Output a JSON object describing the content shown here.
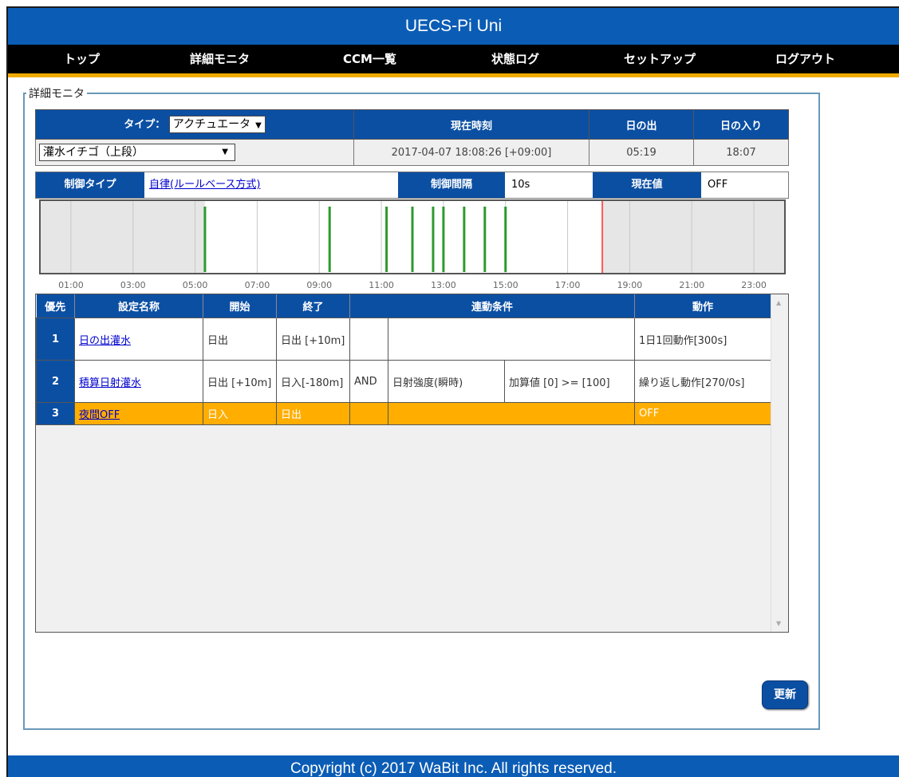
{
  "app_title": "UECS-Pi Uni",
  "nav": [
    "トップ",
    "詳細モニタ",
    "CCM一覧",
    "状態ログ",
    "セットアップ",
    "ログアウト"
  ],
  "section_legend": "詳細モニタ",
  "info": {
    "type_label": "タイプ：",
    "type_value": "アクチュエータ",
    "device_value": "灌水イチゴ（上段）",
    "current_time_label": "現在時刻",
    "current_time": "2017-04-07 18:08:26 [+09:00]",
    "sunrise_label": "日の出",
    "sunrise": "05:19",
    "sunset_label": "日の入り",
    "sunset": "18:07"
  },
  "control": {
    "type_label": "制御タイプ",
    "type_value": "自律(ルールベース方式)",
    "interval_label": "制御間隔",
    "interval_value": "10s",
    "current_label": "現在値",
    "current_value": "OFF"
  },
  "chart_data": {
    "type": "timeline",
    "x_range_hours": [
      0,
      24
    ],
    "x_ticks": [
      "01:00",
      "03:00",
      "05:00",
      "07:00",
      "09:00",
      "11:00",
      "13:00",
      "15:00",
      "17:00",
      "19:00",
      "21:00",
      "23:00"
    ],
    "inactive_before": 5.317,
    "inactive_after": 18.117,
    "current_time": 18.117,
    "on_times": [
      5.317,
      9.333,
      11.167,
      12.0,
      12.667,
      13.0,
      13.667,
      14.333,
      15.0
    ],
    "colors": {
      "on": "#2e9a2e",
      "now": "#ff5a5a",
      "inactive": "#e6e6e6"
    }
  },
  "schedule": {
    "headers": [
      "優先",
      "設定名称",
      "開始",
      "終了",
      "連動条件",
      "動作"
    ],
    "rows": [
      {
        "priority": "1",
        "name": "日の出灌水",
        "start": "日出",
        "end": "日出 [+10m]",
        "logic": "",
        "condition": "",
        "condition_value": "",
        "action": "1日1回動作[300s]"
      },
      {
        "priority": "2",
        "name": "積算日射灌水",
        "start": "日出 [+10m]",
        "end": "日入[-180m]",
        "logic": "AND",
        "condition": "日射強度(瞬時)",
        "condition_value": "加算値 [0] >= [100]",
        "action": "繰り返し動作[270/0s]"
      },
      {
        "priority": "3",
        "name": "夜間OFF",
        "start": "日入",
        "end": "日出",
        "logic": "",
        "condition": "",
        "condition_value": "",
        "action": "OFF"
      }
    ]
  },
  "refresh_label": "更新",
  "footer": "Copyright (c) 2017 WaBit Inc. All rights reserved."
}
